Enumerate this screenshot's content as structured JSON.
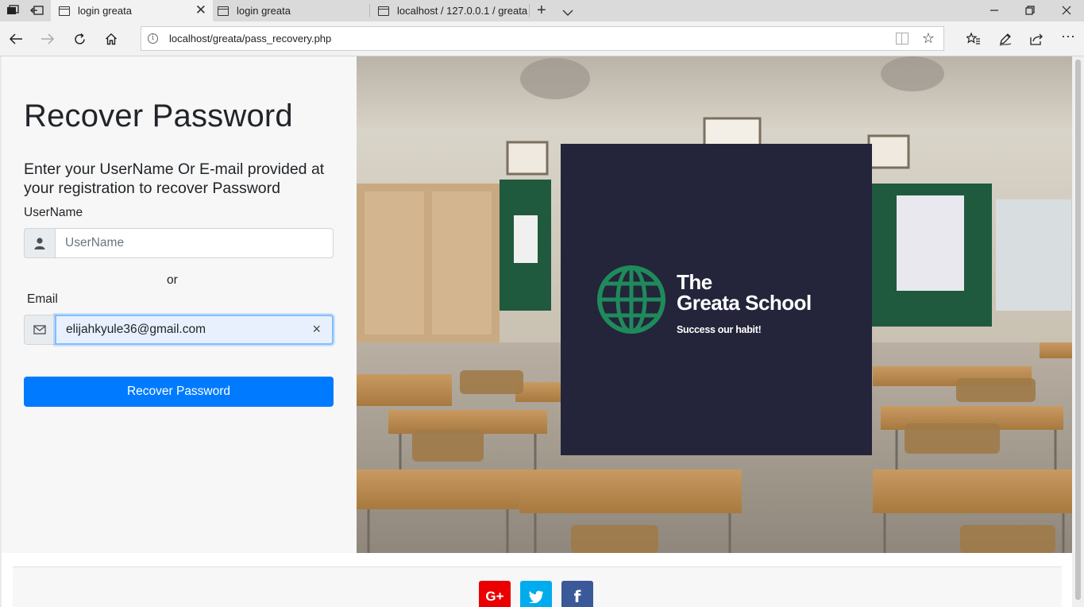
{
  "browser": {
    "tabs": [
      {
        "title": "login greata",
        "active": true
      },
      {
        "title": "login greata",
        "active": false
      },
      {
        "title": "localhost / 127.0.0.1 / greata",
        "active": false
      }
    ],
    "url": "localhost/greata/pass_recovery.php"
  },
  "form": {
    "title": "Recover Password",
    "subtitle": "Enter your UserName Or E-mail provided at your registration to recover Password",
    "username_label": "UserName",
    "username_placeholder": "UserName",
    "username_value": "",
    "or_text": "or",
    "email_label": "Email",
    "email_value": "elijahkyule36@gmail.com",
    "submit_label": "Recover Password",
    "primary_color": "#007bff"
  },
  "logo": {
    "line1": "The",
    "line2": "Greata School",
    "tagline": "Success our habit!",
    "background": "#24243a",
    "globe_color": "#1f8a5b"
  },
  "footer": {
    "social": [
      {
        "name": "google-plus",
        "label": "G+",
        "color": "#ea0000"
      },
      {
        "name": "twitter",
        "label": "twitter",
        "color": "#00aced"
      },
      {
        "name": "facebook",
        "label": "f",
        "color": "#3b5998"
      }
    ]
  }
}
